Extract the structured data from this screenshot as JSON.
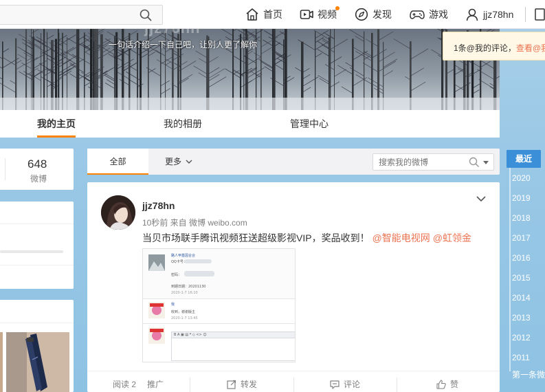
{
  "topnav": {
    "search_placeholder": "",
    "items": [
      {
        "label": "首页",
        "icon": "home-icon"
      },
      {
        "label": "视频",
        "icon": "video-icon"
      },
      {
        "label": "发现",
        "icon": "compass-icon"
      },
      {
        "label": "游戏",
        "icon": "gamepad-icon"
      },
      {
        "label": "jjz78hn",
        "icon": "user-icon"
      }
    ]
  },
  "cover": {
    "username": "jjz78hn",
    "intro": "一句话介绍一下自己吧，让别人更了解你"
  },
  "notification": {
    "text": "1条@我的评论，",
    "link": "查看@我"
  },
  "profile_tabs": [
    "我的主页",
    "我的相册",
    "管理中心"
  ],
  "sidebar": {
    "stat_value": "648",
    "stat_label": "微博"
  },
  "feed": {
    "filter_all": "全部",
    "filter_more": "更多",
    "search_placeholder": "搜索我的微博"
  },
  "post": {
    "username": "jjz78hn",
    "meta": "10秒前 来自 微博 weibo.com",
    "text": "当贝市场联手腾讯视频狂送超级影视VIP，奖品收到！",
    "mention1": "@智能电视网",
    "mention2": "@虹领金",
    "image": {
      "line1": "路人甲基因合合",
      "line2": "QQ卡号：",
      "line3": "密码：",
      "line4": "到期日期：20201130",
      "line5": "2020-1-7 16:10",
      "line6": "我",
      "line7": "收到，谢谢版主",
      "line8": "2020-1-7 13:45",
      "toolbar": "B  A  ▣  ▤  ❝  ◇  <>  ☺"
    },
    "footer": {
      "reads": "阅读 2",
      "promote": "推广",
      "repost": "转发",
      "comment": "评论",
      "like": "赞"
    }
  },
  "timeline": {
    "current": "最近",
    "years": [
      "2020",
      "2019",
      "2018",
      "2017",
      "2016",
      "2015",
      "2014",
      "2013",
      "2012",
      "2011"
    ],
    "first": "第一条微博"
  },
  "colors": {
    "accent_orange": "#ff8200",
    "link_orange": "#eb7350",
    "timeline_blue": "#3b8fd8"
  }
}
